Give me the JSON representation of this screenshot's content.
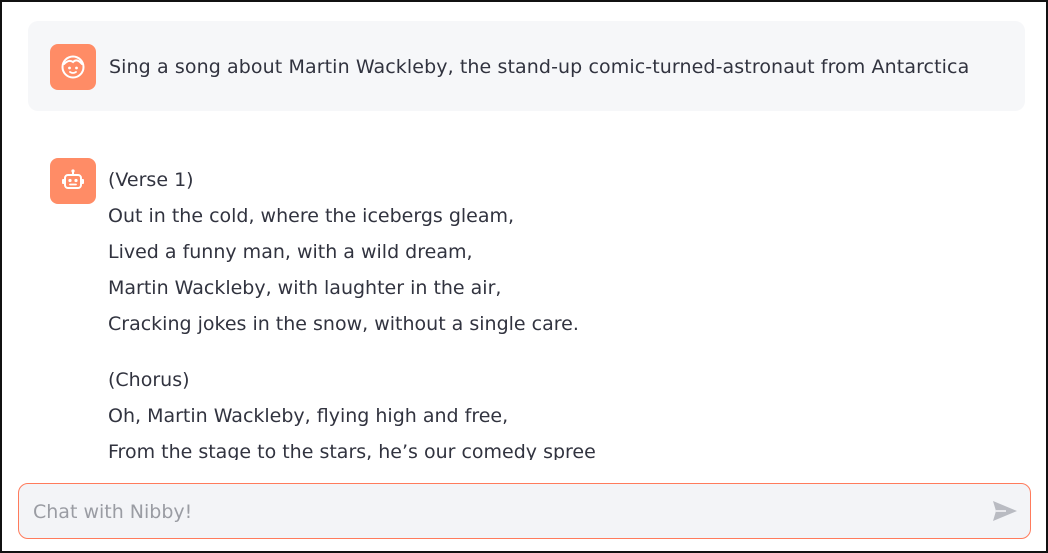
{
  "colors": {
    "avatar_bg": "#ff8c66",
    "input_border": "#ff7b5c",
    "user_bubble_bg": "#f6f7f9",
    "text": "#31333f"
  },
  "user_message": {
    "avatar_icon": "user-face-icon",
    "text": "Sing a song about Martin Wackleby, the stand-up comic-turned-astronaut from Antarctica"
  },
  "assistant_message": {
    "avatar_icon": "robot-icon",
    "stanzas": [
      {
        "lines": [
          "(Verse 1)",
          "Out in the cold, where the icebergs gleam,",
          "Lived a funny man, with a wild dream,",
          "Martin Wackleby, with laughter in the air,",
          "Cracking jokes in the snow, without a single care."
        ]
      },
      {
        "lines": [
          "(Chorus)",
          "Oh, Martin Wackleby, flying high and free,",
          "From the stage to the stars, he’s our comedy spree"
        ]
      }
    ]
  },
  "chat_input": {
    "placeholder": "Chat with Nibby!",
    "value": "",
    "send_icon": "send-icon"
  }
}
